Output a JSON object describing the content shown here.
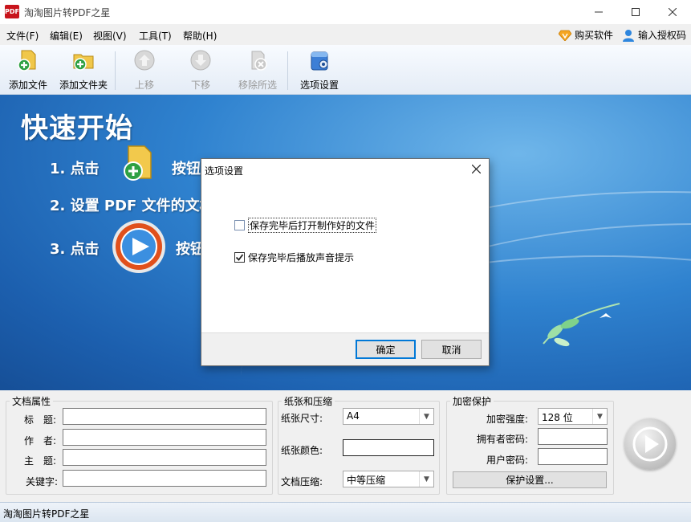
{
  "window": {
    "title": "淘淘图片转PDF之星",
    "app_icon_text": "PDF"
  },
  "menu": {
    "items": [
      "文件(F)",
      "编辑(E)",
      "视图(V)",
      "工具(T)",
      "帮助(H)"
    ],
    "buy": "购买软件",
    "register": "输入授权码"
  },
  "toolbar": {
    "add_file": "添加文件",
    "add_folder": "添加文件夹",
    "move_up": "上移",
    "move_down": "下移",
    "remove_selected": "移除所选",
    "options": "选项设置"
  },
  "banner": {
    "heading": "快速开始",
    "step1_prefix": "1. 点击",
    "step1_suffix": "按钮",
    "step2": "2. 设置 PDF 文件的文档",
    "step3_prefix": "3. 点击",
    "step3_suffix": "按钮"
  },
  "dialog": {
    "title": "选项设置",
    "option1": "保存完毕后打开制作好的文件",
    "option1_checked": false,
    "option2": "保存完毕后播放声音提示",
    "option2_checked": true,
    "ok": "确定",
    "cancel": "取消"
  },
  "doc_props": {
    "legend": "文档属性",
    "title_label": "标　题:",
    "author_label": "作　者:",
    "subject_label": "主　题:",
    "keywords_label": "关键字:",
    "title_value": "",
    "author_value": "",
    "subject_value": "",
    "keywords_value": ""
  },
  "paper": {
    "legend": "纸张和压缩",
    "size_label": "纸张尺寸:",
    "size_value": "A4",
    "color_label": "纸张颜色:",
    "compress_label": "文档压缩:",
    "compress_value": "中等压缩"
  },
  "encrypt": {
    "legend": "加密保护",
    "strength_label": "加密强度:",
    "strength_value": "128 位",
    "owner_label": "拥有者密码:",
    "user_label": "用户密码:",
    "owner_value": "",
    "user_value": "",
    "protect_button": "保护设置..."
  },
  "status": {
    "text": "淘淘图片转PDF之星"
  },
  "colors": {
    "banner_blue": "#2f82cf",
    "accent": "#0078d7"
  }
}
